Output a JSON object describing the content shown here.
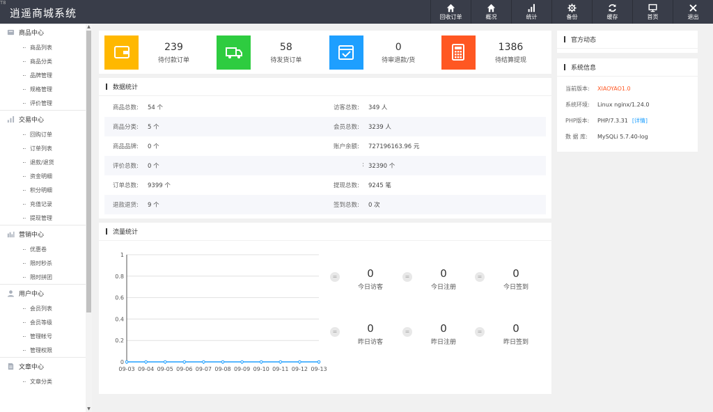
{
  "corner_label": "T8",
  "app_title": "逍遥商城系统",
  "colors": {
    "topbar": "#393d49",
    "card_yellow": "#ffb800",
    "card_green": "#2ecc40",
    "card_blue": "#1e9fff",
    "card_orange": "#ff5722",
    "axis": "#1e9fff"
  },
  "top_nav": [
    {
      "label": "回收订单",
      "icon": "home-icon"
    },
    {
      "label": "概况",
      "icon": "home-icon"
    },
    {
      "label": "统计",
      "icon": "bar-chart-icon"
    },
    {
      "label": "备份",
      "icon": "gear-icon"
    },
    {
      "label": "缓存",
      "icon": "refresh-icon"
    },
    {
      "label": "首页",
      "icon": "monitor-icon"
    },
    {
      "label": "退出",
      "icon": "close-icon"
    }
  ],
  "sidebar": [
    {
      "title": "商品中心",
      "icon": "product-icon",
      "items": [
        "商品列表",
        "商品分类",
        "品牌管理",
        "规格管理",
        "评价管理"
      ]
    },
    {
      "title": "交易中心",
      "icon": "bar-chart-icon",
      "items": [
        "回购订单",
        "订单列表",
        "退款/退货",
        "资金明细",
        "积分明细",
        "充值记录",
        "提现管理"
      ]
    },
    {
      "title": "营销中心",
      "icon": "marketing-icon",
      "items": [
        "优惠卷",
        "限时秒杀",
        "限时拼团"
      ]
    },
    {
      "title": "用户中心",
      "icon": "user-icon",
      "items": [
        "会员列表",
        "会员等级",
        "管理帐号",
        "管理权限"
      ]
    },
    {
      "title": "文章中心",
      "icon": "document-icon",
      "items": [
        "文章分类"
      ]
    }
  ],
  "cards": [
    {
      "value": "239",
      "label": "待付款订单",
      "icon": "wallet-icon"
    },
    {
      "value": "58",
      "label": "待发货订单",
      "icon": "truck-icon"
    },
    {
      "value": "0",
      "label": "待审退款/货",
      "icon": "check-box-icon"
    },
    {
      "value": "1386",
      "label": "待结算提现",
      "icon": "calculator-icon"
    }
  ],
  "stats": {
    "title": "数据统计",
    "rows": [
      [
        {
          "k": "商品总数:",
          "v": "54 个"
        },
        {
          "k": "访客总数:",
          "v": "349 人"
        }
      ],
      [
        {
          "k": "商品分类:",
          "v": "5 个"
        },
        {
          "k": "会员总数:",
          "v": "3239 人"
        }
      ],
      [
        {
          "k": "商品品牌:",
          "v": "0 个"
        },
        {
          "k": "账户余额:",
          "v": "727196163.96 元"
        }
      ],
      [
        {
          "k": "评价总数:",
          "v": "0 个"
        },
        {
          "k": ":",
          "v": "32390 个"
        }
      ],
      [
        {
          "k": "订单总数:",
          "v": "9399 个"
        },
        {
          "k": "提现总数:",
          "v": "9245 笔"
        }
      ],
      [
        {
          "k": "退款退货:",
          "v": "9 个"
        },
        {
          "k": "签到总数:",
          "v": "0 次"
        }
      ]
    ]
  },
  "traffic": {
    "title": "流量统计",
    "today": [
      {
        "value": "0",
        "label": "今日访客"
      },
      {
        "value": "0",
        "label": "今日注册"
      },
      {
        "value": "0",
        "label": "今日签到"
      }
    ],
    "yesterday": [
      {
        "value": "0",
        "label": "昨日访客"
      },
      {
        "value": "0",
        "label": "昨日注册"
      },
      {
        "value": "0",
        "label": "昨日签到"
      }
    ],
    "dot_symbol": "="
  },
  "chart_data": {
    "type": "line",
    "x": [
      "09-03",
      "09-04",
      "09-05",
      "09-06",
      "09-07",
      "09-08",
      "09-09",
      "09-10",
      "09-11",
      "09-12",
      "09-13"
    ],
    "series": [
      {
        "values": [
          0,
          0,
          0,
          0,
          0,
          0,
          0,
          0,
          0,
          0,
          0
        ]
      }
    ],
    "ylim": [
      0,
      1
    ],
    "yticks": [
      "0",
      "0.2",
      "0.4",
      "0.6",
      "0.8",
      "1"
    ],
    "grid": true
  },
  "news": {
    "title": "官方动态"
  },
  "sysinfo": {
    "title": "系统信息",
    "rows": [
      {
        "k": "当前版本:",
        "v": "XIAOYAO1.0",
        "accent": true
      },
      {
        "k": "系统环境:",
        "v": "Linux nginx/1.24.0"
      },
      {
        "k": "PHP版本:",
        "v": "PHP/7.3.31",
        "link": "[详情]"
      },
      {
        "k": "数 据 库:",
        "v": "MySQLi 5.7.40-log"
      }
    ]
  }
}
